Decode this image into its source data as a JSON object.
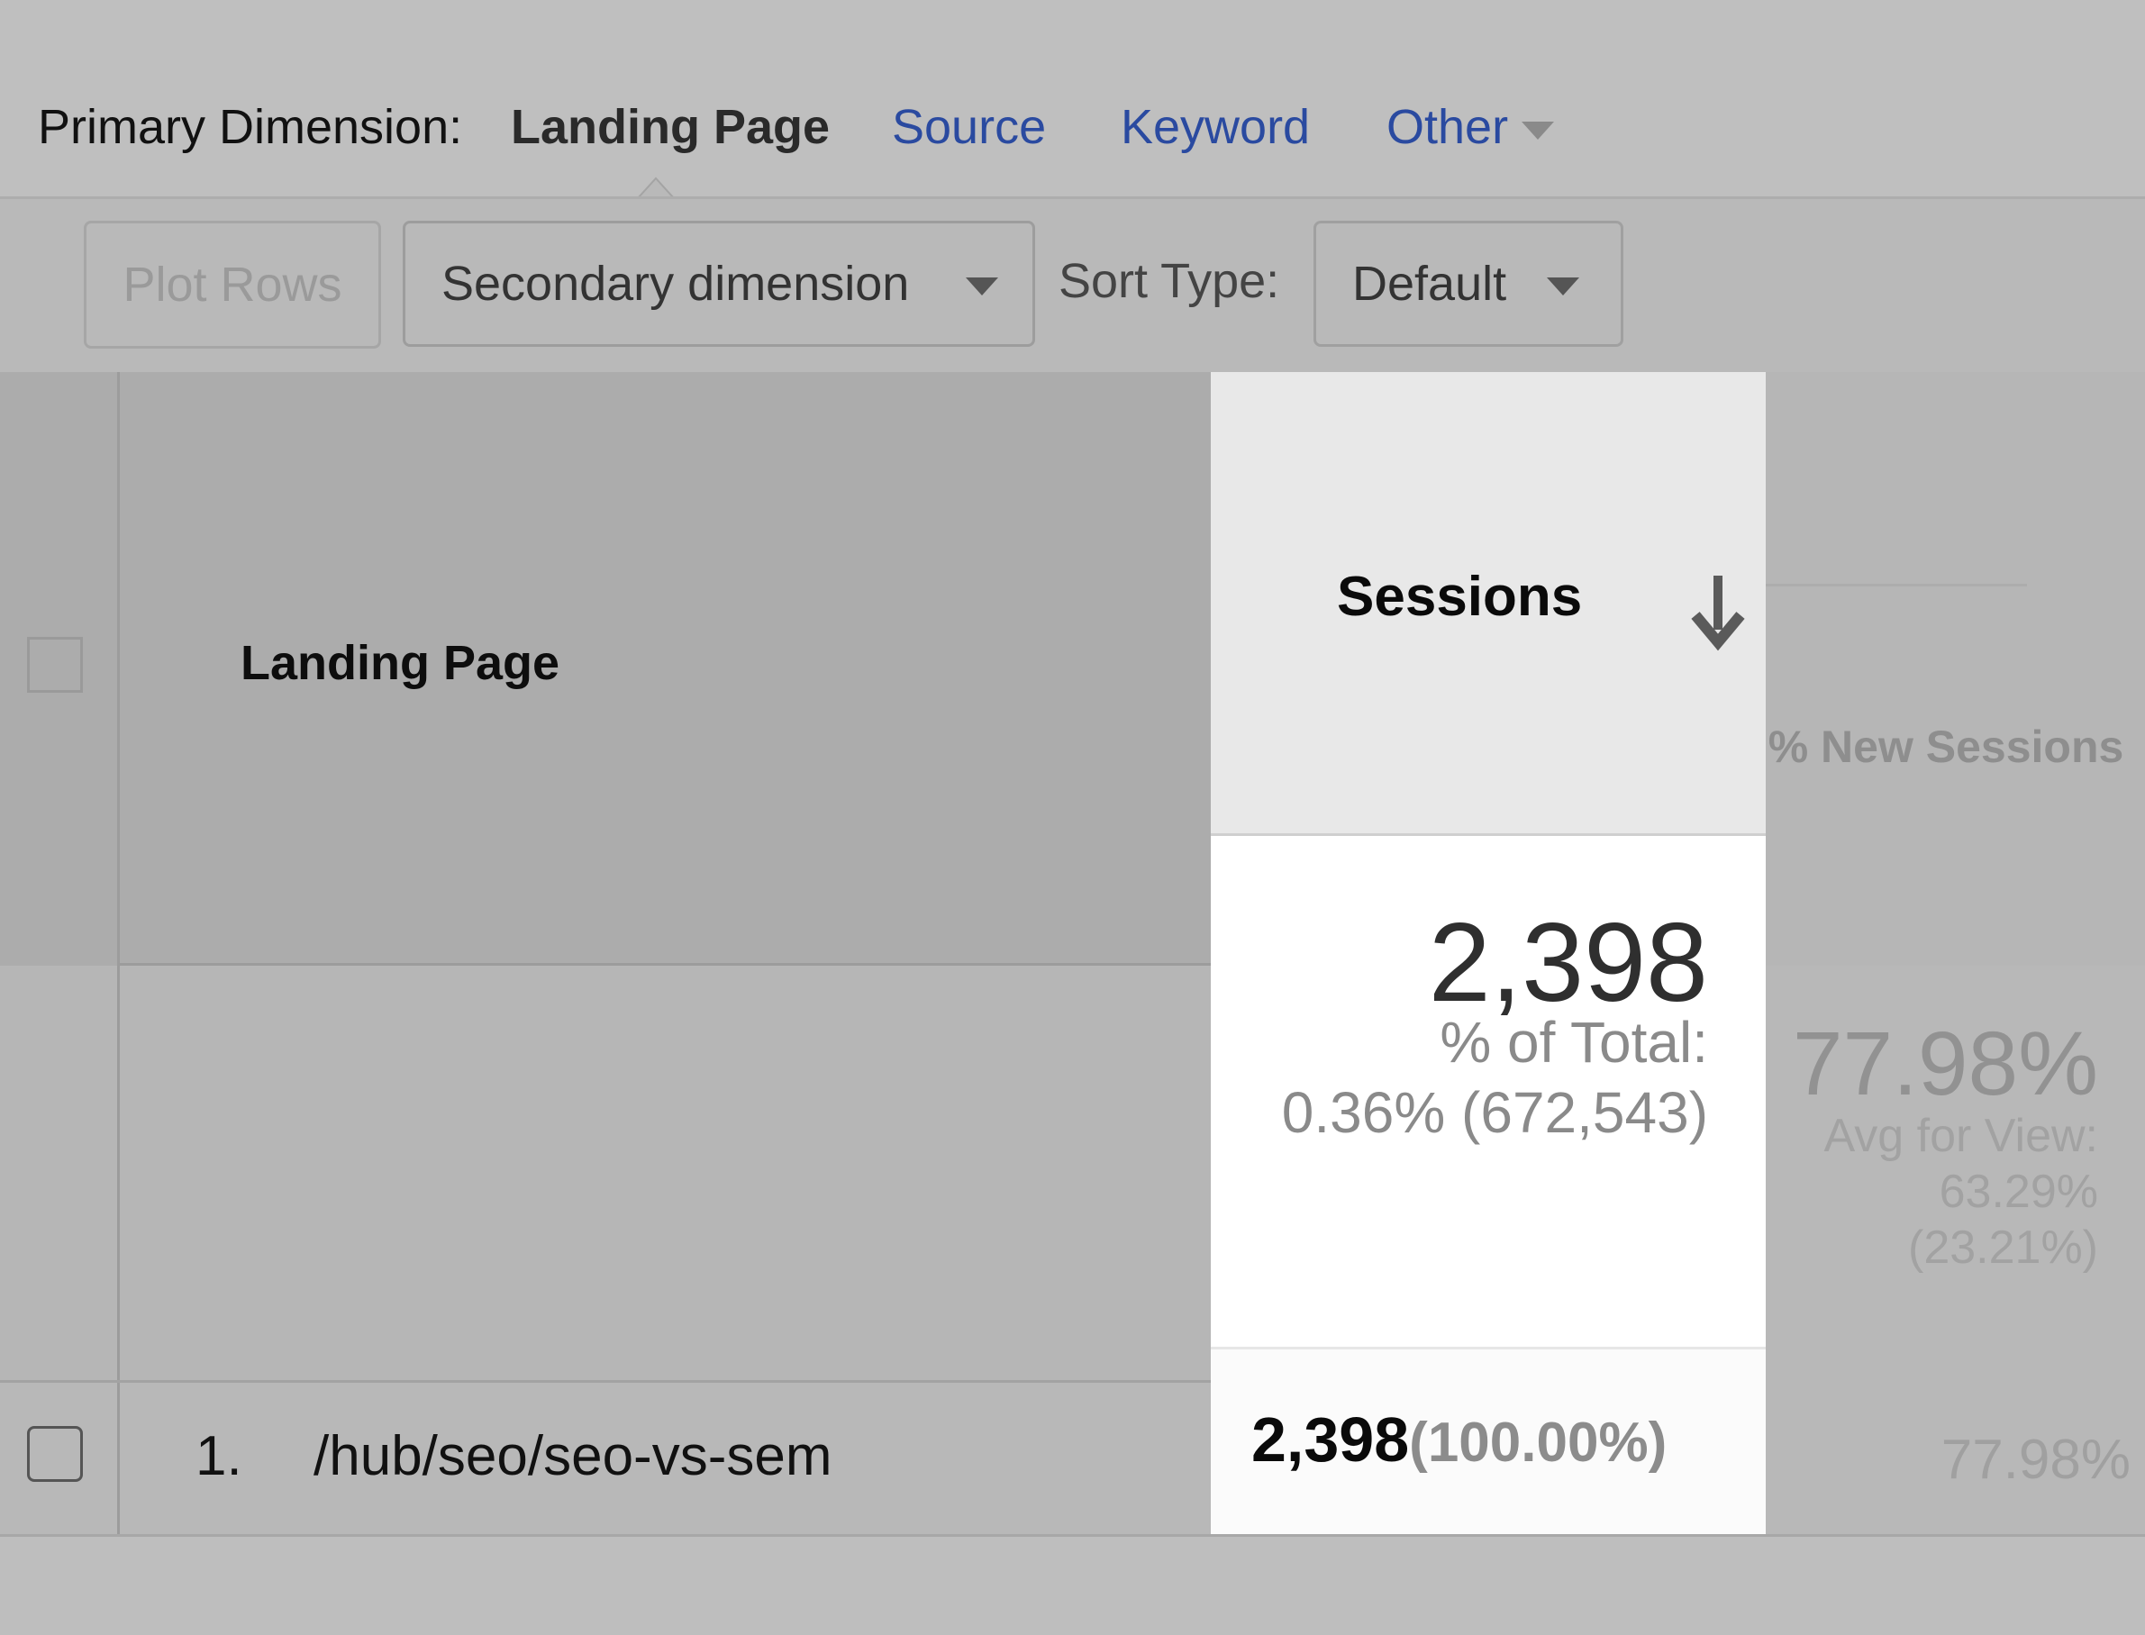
{
  "primary_dimension": {
    "label": "Primary Dimension:",
    "active": "Landing Page",
    "links": [
      "Source",
      "Keyword",
      "Other"
    ],
    "link_color": "#2a4aa0"
  },
  "toolbar": {
    "plot_rows_label": "Plot Rows",
    "secondary_dimension_label": "Secondary dimension",
    "sort_type_label": "Sort Type:",
    "sort_type_value": "Default"
  },
  "table": {
    "columns": {
      "landing_page": "Landing Page",
      "sessions": "Sessions",
      "new_sessions": "% New Sessions",
      "sort_icon": "arrow-down-icon"
    },
    "totals": {
      "sessions_value": "2,398",
      "sessions_pct_label": "% of Total:",
      "sessions_pct_detail": "0.36% (672,543)",
      "new_sessions_value": "77.98%",
      "new_sessions_avg_label": "Avg for View:",
      "new_sessions_avg_value": "63.29%",
      "new_sessions_avg_delta": "(23.21%)"
    },
    "rows": [
      {
        "index": "1.",
        "landing_page": "/hub/seo/seo-vs-sem",
        "sessions": "2,398",
        "sessions_pct": "(100.00%)",
        "new_sessions": "77.98%"
      }
    ]
  }
}
